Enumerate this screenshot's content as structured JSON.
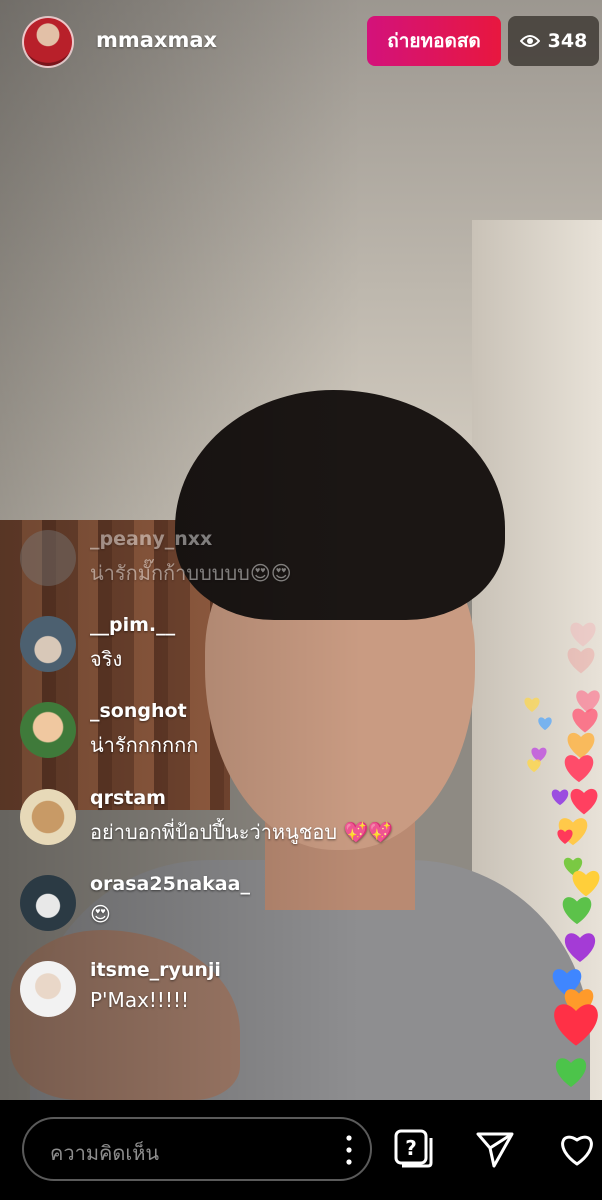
{
  "header": {
    "host_username": "mmaxmax",
    "live_label": "ถ่ายทอดสด",
    "viewer_count": "348"
  },
  "comments": [
    {
      "username": "_peany_nxx",
      "text": "น่ารักมั๊กก้าบบบบบ",
      "emoji": "😍😍",
      "faded": true
    },
    {
      "username": "__pim.__",
      "text": "จริง",
      "emoji": ""
    },
    {
      "username": "_songhot",
      "text": "น่ารักกกกกก",
      "emoji": ""
    },
    {
      "username": "qrstam",
      "text": "อย่าบอกพี่ป้อปปี้นะว่าหนูชอบ",
      "emoji": "💖💖"
    },
    {
      "username": "orasa25nakaa_",
      "text": "",
      "emoji": "😍"
    },
    {
      "username": "itsme_ryunji",
      "text": "P'Max!!!!!",
      "emoji": ""
    }
  ],
  "composer": {
    "placeholder": "ความคิดเห็น"
  },
  "icons": {
    "viewers": "eye-icon",
    "more": "more-vertical-icon",
    "question": "question-sticker-icon",
    "share": "send-icon",
    "like": "heart-outline-icon"
  },
  "colors": {
    "live_gradient_start": "#d3127b",
    "live_gradient_end": "#e8173f",
    "viewer_badge": "#37322d"
  }
}
